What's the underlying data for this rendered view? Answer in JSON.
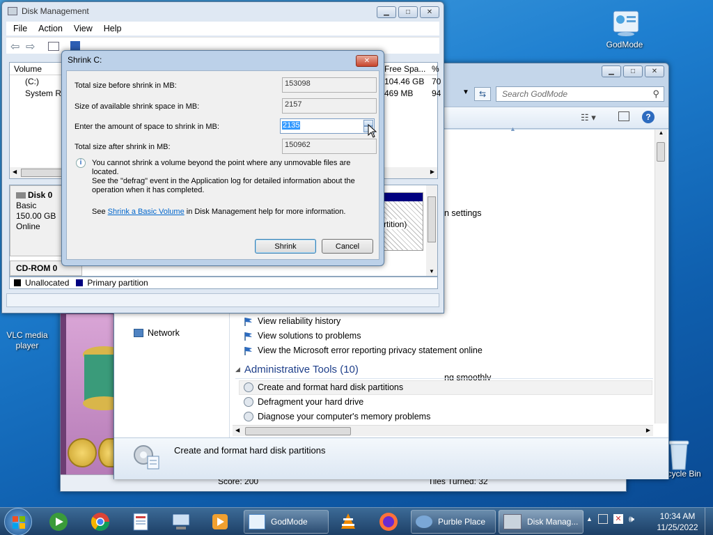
{
  "desktop": {
    "icons": {
      "godmode": "GodMode",
      "vlc": "VLC media player",
      "recycle": "Recycle Bin"
    }
  },
  "disk_mgmt": {
    "title": "Disk Management",
    "menu": [
      "File",
      "Action",
      "View",
      "Help"
    ],
    "columns": [
      "Volume",
      "Free Spa...",
      "%"
    ],
    "rows": [
      {
        "volume": "(C:)",
        "free": "104.46 GB",
        "pct": "70"
      },
      {
        "volume": "System Re",
        "free": "469 MB",
        "pct": "94"
      }
    ],
    "disk0": {
      "name": "Disk 0",
      "type": "Basic",
      "size": "150.00 GB",
      "status": "Online"
    },
    "cdrom": "CD-ROM 0",
    "partition_text": "rtition)",
    "legend": {
      "unallocated": "Unallocated",
      "primary": "Primary partition"
    }
  },
  "godmode": {
    "search_placeholder": "Search GodMode",
    "partial_settings": "n settings",
    "partial_smoothly": "ng smoothly",
    "nav_network": "Network",
    "links": [
      "View reliability history",
      "View solutions to problems",
      "View the Microsoft error reporting privacy statement online"
    ],
    "section_title": "Administrative Tools (10)",
    "admin_items": [
      "Create and format hard disk partitions",
      "Defragment your hard drive",
      "Diagnose your computer's memory problems"
    ],
    "details_text": "Create and format hard disk partitions"
  },
  "game": {
    "title": "Purble Place",
    "score": "Score: 200",
    "turned": "Tiles Turned: 32"
  },
  "shrink_dialog": {
    "title": "Shrink C:",
    "total_before_label": "Total size before shrink in MB:",
    "total_before": "153098",
    "available_label": "Size of available shrink space in MB:",
    "available": "2157",
    "amount_label": "Enter the amount of space to shrink in MB:",
    "amount": "2135",
    "total_after_label": "Total size after shrink in MB:",
    "total_after": "150962",
    "info_line1": "You cannot shrink a volume beyond the point where any unmovable files are located.",
    "info_line2": "See the \"defrag\" event in the Application log for detailed information about the",
    "info_line3": "operation when it has completed.",
    "see_prefix": "See",
    "see_link": "Shrink a Basic Volume",
    "see_suffix": "in Disk Management help for more information.",
    "shrink_btn": "Shrink",
    "cancel_btn": "Cancel"
  },
  "taskbar": {
    "godmode": "GodMode",
    "purble": "Purble Place",
    "diskmgmt": "Disk Manag...",
    "time": "10:34 AM",
    "date": "11/25/2022"
  }
}
